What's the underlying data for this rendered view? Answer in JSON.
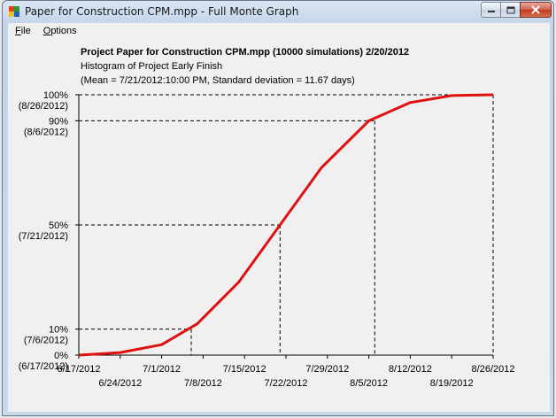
{
  "window": {
    "title": "Paper for Construction CPM.mpp - Full Monte Graph",
    "buttons": {
      "minimize": "minimize",
      "maximize": "maximize",
      "close": "close"
    }
  },
  "menu": [
    {
      "label": "File",
      "accel": "F",
      "rest": "ile"
    },
    {
      "label": "Options",
      "accel": "O",
      "rest": "ptions"
    }
  ],
  "colors": {
    "curve": "#e01010",
    "axis": "#000000",
    "guide": "#000000"
  },
  "chart_data": {
    "type": "line",
    "title": "Project Paper for Construction CPM.mpp (10000 simulations) 2/20/2012",
    "subtitle": "Histogram of Project Early Finish",
    "stats_line": "(Mean = 7/21/2012:10:00 PM, Standard deviation = 11.67 days)",
    "xlabel": "",
    "ylabel": "",
    "x_ticks": [
      "6/17/2012",
      "6/24/2012",
      "7/1/2012",
      "7/8/2012",
      "7/15/2012",
      "7/22/2012",
      "7/29/2012",
      "8/5/2012",
      "8/12/2012",
      "8/19/2012",
      "8/26/2012"
    ],
    "x_range": [
      "6/17/2012",
      "8/26/2012"
    ],
    "y_range": [
      0,
      100
    ],
    "y_markers": [
      {
        "percent": "0%",
        "date": "(6/17/2012)",
        "value": 0,
        "x": "6/17/2012"
      },
      {
        "percent": "10%",
        "date": "(7/6/2012)",
        "value": 10,
        "x": "7/6/2012"
      },
      {
        "percent": "50%",
        "date": "(7/21/2012)",
        "value": 50,
        "x": "7/21/2012"
      },
      {
        "percent": "90%",
        "date": "(8/6/2012)",
        "value": 90,
        "x": "8/6/2012"
      },
      {
        "percent": "100%",
        "date": "(8/26/2012)",
        "value": 100,
        "x": "8/26/2012"
      }
    ],
    "series": [
      {
        "x": [
          "6/17/2012",
          "6/24/2012",
          "7/1/2012",
          "7/7/2012",
          "7/14/2012",
          "7/21/2012",
          "7/28/2012",
          "8/5/2012",
          "8/12/2012",
          "8/19/2012",
          "8/26/2012"
        ],
        "y": [
          0,
          1,
          4,
          12,
          28,
          50,
          72,
          90,
          97,
          99.7,
          100
        ]
      }
    ],
    "grid": false
  }
}
